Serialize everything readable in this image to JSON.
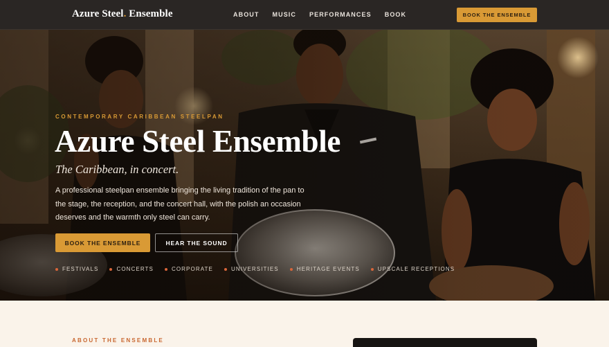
{
  "nav": {
    "brand_main": "Azure Steel",
    "brand_dot": ".",
    "brand_tail": " Ensemble",
    "links": [
      "ABOUT",
      "MUSIC",
      "PERFORMANCES",
      "BOOK"
    ],
    "cta": "BOOK THE ENSEMBLE"
  },
  "hero": {
    "eyebrow": "CONTEMPORARY CARIBBEAN STEELPAN",
    "title": "Azure Steel Ensemble",
    "subtitle": "The Caribbean, in concert.",
    "body": "A professional steelpan ensemble bringing the living tradition of the pan to the stage, the reception, and the concert hall, with the polish an occasion deserves and the warmth only steel can carry.",
    "primary_button": "BOOK THE ENSEMBLE",
    "secondary_button": "HEAR THE SOUND",
    "tags": [
      "FESTIVALS",
      "CONCERTS",
      "CORPORATE",
      "UNIVERSITIES",
      "HERITAGE EVENTS",
      "UPSCALE RECEPTIONS"
    ]
  },
  "about": {
    "eyebrow": "ABOUT THE ENSEMBLE"
  },
  "colors": {
    "accent": "#d99a35",
    "nav_bg": "#2a2624",
    "bullet": "#d9663a",
    "page_bg": "#faf3ea"
  }
}
